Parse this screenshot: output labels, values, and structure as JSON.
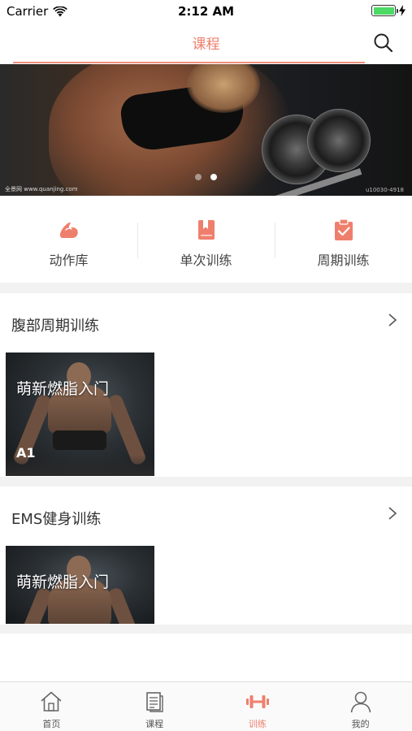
{
  "status_bar": {
    "carrier": "Carrier",
    "time": "2:12 AM",
    "battery_level": 1.0
  },
  "nav": {
    "title": "课程",
    "search_icon": "search-icon"
  },
  "banner": {
    "caption": "全景网 www.quanjing.com",
    "code": "u10030-4918",
    "pages": 2,
    "active_page": 2
  },
  "quick_menu": [
    {
      "label": "动作库",
      "icon": "muscle-arm-icon"
    },
    {
      "label": "单次训练",
      "icon": "bookmark-book-icon"
    },
    {
      "label": "周期训练",
      "icon": "clipboard-check-icon"
    }
  ],
  "sections": [
    {
      "title": "腹部周期训练",
      "card": {
        "title": "萌新燃脂入门",
        "badge": "A1"
      }
    },
    {
      "title": "EMS健身训练",
      "card": {
        "title": "萌新燃脂入门"
      }
    }
  ],
  "tab_bar": {
    "tabs": [
      {
        "label": "首页",
        "icon": "home-icon"
      },
      {
        "label": "课程",
        "icon": "document-icon"
      },
      {
        "label": "训练",
        "icon": "dumbbell-icon",
        "active": true
      },
      {
        "label": "我的",
        "icon": "profile-icon"
      }
    ]
  },
  "colors": {
    "accent": "#ef7f6d",
    "section_gap": "#f2f2f2",
    "text": "#333333",
    "tab_inactive": "#555555"
  }
}
